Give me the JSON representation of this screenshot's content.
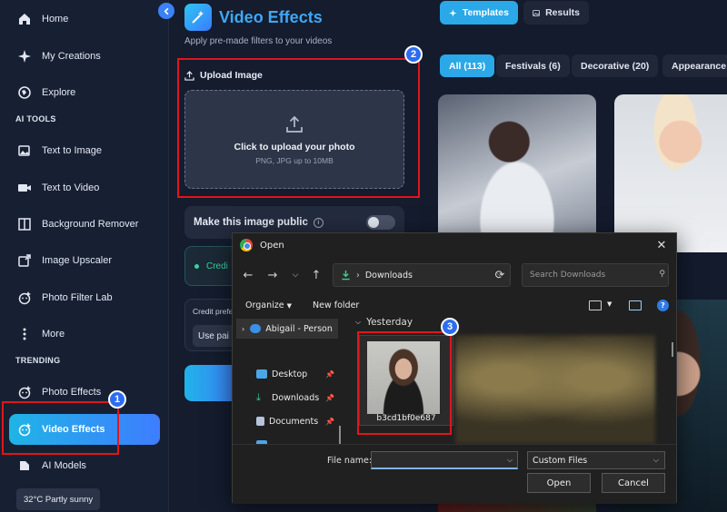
{
  "sidebar": {
    "items": [
      {
        "label": "Home"
      },
      {
        "label": "My Creations"
      },
      {
        "label": "Explore"
      }
    ],
    "ai_tools_label": "AI TOOLS",
    "ai_tools": [
      {
        "label": "Text to Image"
      },
      {
        "label": "Text to Video"
      },
      {
        "label": "Background Remover"
      },
      {
        "label": "Image Upscaler"
      },
      {
        "label": "Photo Filter Lab"
      },
      {
        "label": "More"
      }
    ],
    "trending_label": "TRENDING",
    "trending": [
      {
        "label": "Photo Effects"
      },
      {
        "label": "Video Effects"
      },
      {
        "label": "AI Models"
      }
    ],
    "weather": "32°C Partly sunny"
  },
  "panel": {
    "title": "Video Effects",
    "subtitle": "Apply pre-made filters to your videos",
    "upload_label": "Upload Image",
    "upload_main": "Click to upload your photo",
    "upload_hint": "PNG, JPG up to 10MB",
    "public_label": "Make this image public",
    "credit_text": "Credi",
    "pref_title": "Credit prefe",
    "pref_button": "Use pai"
  },
  "gallery": {
    "tabs": [
      {
        "label": "Templates"
      },
      {
        "label": "Results"
      }
    ],
    "chips": [
      {
        "label": "All (113)"
      },
      {
        "label": "Festivals (6)"
      },
      {
        "label": "Decorative (20)"
      },
      {
        "label": "Appearance ("
      }
    ]
  },
  "dialog": {
    "title": "Open",
    "address": "Downloads",
    "search_placeholder": "Search Downloads",
    "organize": "Organize",
    "new_folder": "New folder",
    "tree": [
      {
        "label": "Abigail - Person"
      },
      {
        "label": "Desktop"
      },
      {
        "label": "Downloads"
      },
      {
        "label": "Documents"
      }
    ],
    "group": "Yesterday",
    "file_name": "b3cd1bf0e687",
    "file_name_label": "File name:",
    "file_name_value": "",
    "file_type": "Custom Files",
    "open_button": "Open",
    "cancel_button": "Cancel"
  },
  "annotations": [
    "1",
    "2",
    "3"
  ],
  "colors": {
    "accent": "#3e7dff",
    "highlight": "#e0161d",
    "success": "#3ad29f"
  }
}
